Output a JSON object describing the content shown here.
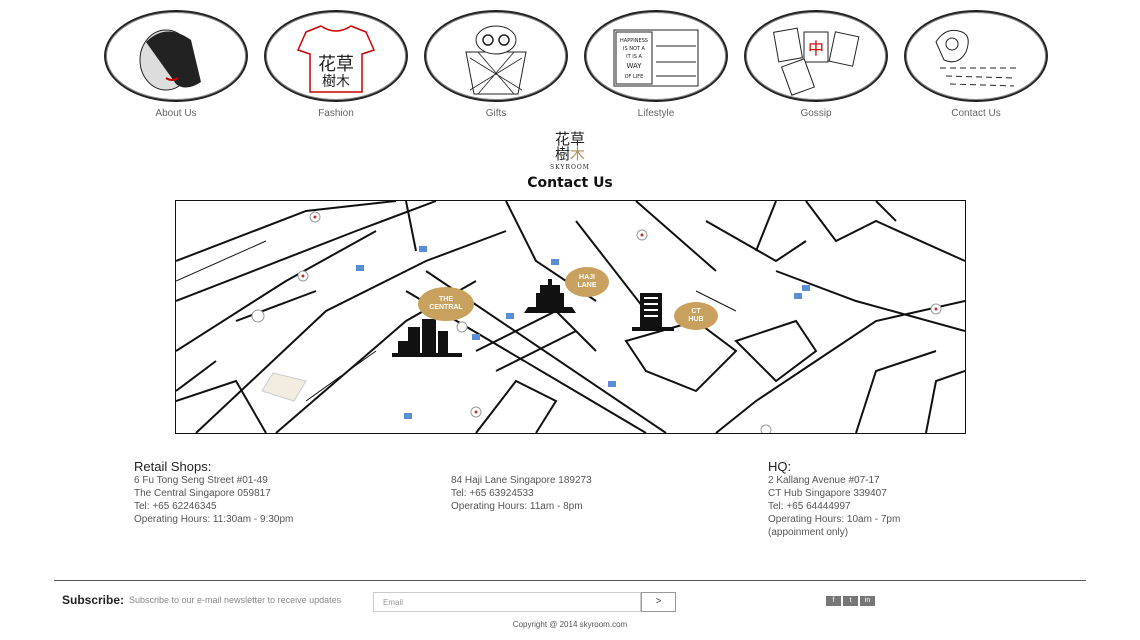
{
  "nav": {
    "items": [
      {
        "label": "About Us",
        "icon": "woman-portrait-icon"
      },
      {
        "label": "Fashion",
        "icon": "tshirt-icon"
      },
      {
        "label": "Gifts",
        "icon": "basket-icon"
      },
      {
        "label": "Lifestyle",
        "icon": "happiness-poster-icon"
      },
      {
        "label": "Gossip",
        "icon": "mahjong-tiles-icon"
      },
      {
        "label": "Contact Us",
        "icon": "telephone-icon"
      }
    ]
  },
  "logo": {
    "line1": "花草",
    "line2a": "樹",
    "line2b": "木",
    "sub": "SKYROOM"
  },
  "page_title": "Contact Us",
  "map": {
    "badges": [
      {
        "line1": "THE",
        "line2": "CENTRAL"
      },
      {
        "line1": "HAJI",
        "line2": "LANE"
      },
      {
        "line1": "CT",
        "line2": "HUB"
      }
    ]
  },
  "retail": {
    "heading": "Retail Shops:",
    "lines": [
      "6 Fu Tong Seng Street #01-49",
      "The Central Singapore 059817",
      "Tel: +65 62246345",
      "Operating Hours: 11:30am - 9:30pm"
    ]
  },
  "haji": {
    "lines": [
      "84 Haji Lane Singapore 189273",
      "Tel: +65 63924533",
      "Operating Hours: 11am - 8pm"
    ]
  },
  "hq": {
    "heading": "HQ:",
    "lines": [
      "2 Kallang Avenue #07-17",
      "CT Hub Singapore 339407",
      "Tel: +65 64444997",
      "Operating Hours: 10am - 7pm",
      "(appoinment only)"
    ]
  },
  "subscribe": {
    "label": "Subscribe:",
    "description": "Subscribe to our e-mail newsletter to receive updates",
    "placeholder": "Email",
    "button": ">"
  },
  "social": [
    "f",
    "t",
    "in"
  ],
  "copyright": "Copyright @ 2014 skyroom.com",
  "colors": {
    "accent_gold": "#c9a15e",
    "text": "#333333",
    "divider": "#555555"
  }
}
